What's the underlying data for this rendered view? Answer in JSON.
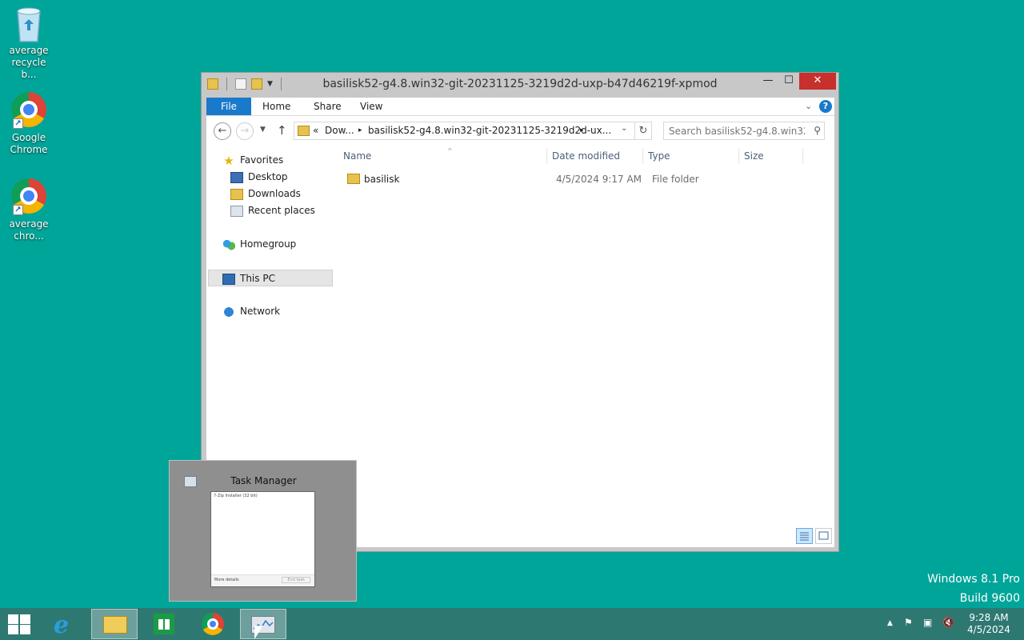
{
  "desktop": {
    "icons": [
      {
        "label": "average recycle b...",
        "icon": "recycle-bin-icon"
      },
      {
        "label": "Google Chrome",
        "icon": "chrome-icon"
      },
      {
        "label": "average chro...",
        "icon": "chrome-icon"
      }
    ],
    "watermark": {
      "line1": "Windows 8.1 Pro",
      "line2": "Build 9600"
    }
  },
  "explorer": {
    "title": "basilisk52-g4.8.win32-git-20231125-3219d2d-uxp-b47d46219f-xpmod",
    "window_buttons": {
      "minimize": "—",
      "maximize": "☐",
      "close": "✕"
    },
    "ribbon": {
      "tabs": [
        "File",
        "Home",
        "Share",
        "View"
      ]
    },
    "address": {
      "crumbs": [
        "«",
        "Dow...",
        "▸",
        "basilisk52-g4.8.win32-git-20231125-3219d2d-ux...",
        "▸"
      ],
      "search_placeholder": "Search basilisk52-g4.8.win32-..."
    },
    "nav_pane": {
      "favorites": "Favorites",
      "desktop": "Desktop",
      "downloads": "Downloads",
      "recent": "Recent places",
      "homegroup": "Homegroup",
      "this_pc": "This PC",
      "network": "Network"
    },
    "columns": {
      "name": "Name",
      "date": "Date modified",
      "type": "Type",
      "size": "Size"
    },
    "files": [
      {
        "name": "basilisk",
        "date": "4/5/2024 9:17 AM",
        "type": "File folder",
        "size": ""
      }
    ]
  },
  "thumbnail": {
    "title": "Task Manager",
    "preview_line": "7-Zip Installer (32 bit)",
    "more_details": "More details",
    "end_task": "End task"
  },
  "taskbar": {
    "apps": [
      "internet-explorer-icon",
      "file-explorer-icon",
      "store-icon",
      "chrome-icon",
      "task-manager-icon"
    ],
    "time": "9:28 AM",
    "date": "4/5/2024"
  },
  "colors": {
    "desktop": "#00a599",
    "taskbar": "#2e7872",
    "accent": "#1979ca",
    "close": "#c7302c"
  }
}
